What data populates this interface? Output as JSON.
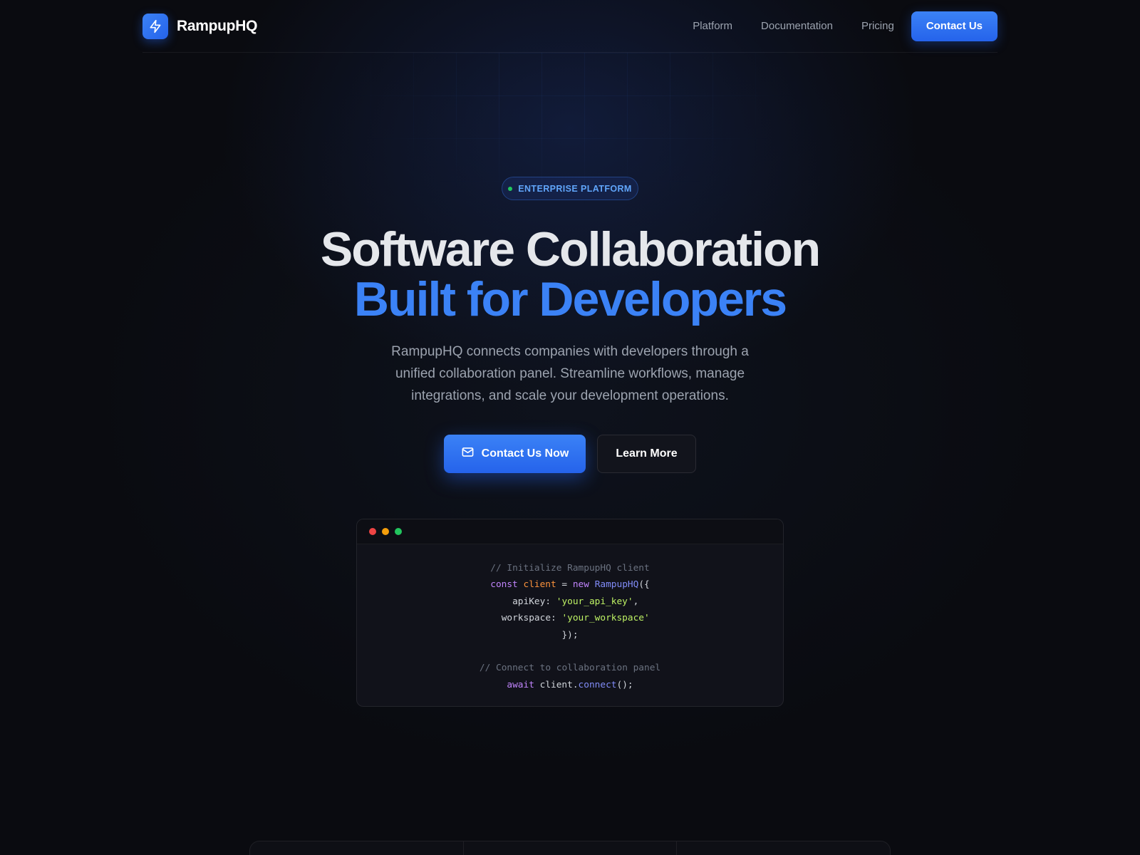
{
  "nav": {
    "brand_name": "RampupHQ",
    "links": [
      "Platform",
      "Documentation",
      "Pricing"
    ],
    "cta_label": "Contact Us"
  },
  "hero": {
    "badge": "ENTERPRISE PLATFORM",
    "title_line1": "Software Collaboration",
    "title_line2": "Built for Developers",
    "subtitle": "RampupHQ connects companies with developers through a unified collaboration panel. Streamline workflows, manage integrations, and scale your development operations.",
    "primary_button": "Contact Us Now",
    "secondary_button": "Learn More"
  },
  "code": {
    "comment1": "// Initialize RampupHQ client",
    "kw_const": "const",
    "var_client": "client",
    "op_eq": " = ",
    "kw_new": "new",
    "class_name": "RampupHQ",
    "open_paren": "({",
    "key_api": "apiKey: ",
    "val_api": "'your_api_key'",
    "comma": ",",
    "key_ws": "workspace: ",
    "val_ws": "'your_workspace'",
    "close": "});",
    "comment2": "// Connect to collaboration panel",
    "kw_await": "await",
    "obj": " client.",
    "method": "connect",
    "call_end": "();"
  },
  "colors": {
    "accent": "#3b82f6",
    "background": "#0a0b10",
    "dot_red": "#ef4444",
    "dot_yellow": "#f59e0b",
    "dot_green": "#22c55e"
  },
  "icons": {
    "logo": "lightning-bolt-icon",
    "primary_button": "mail-icon"
  }
}
